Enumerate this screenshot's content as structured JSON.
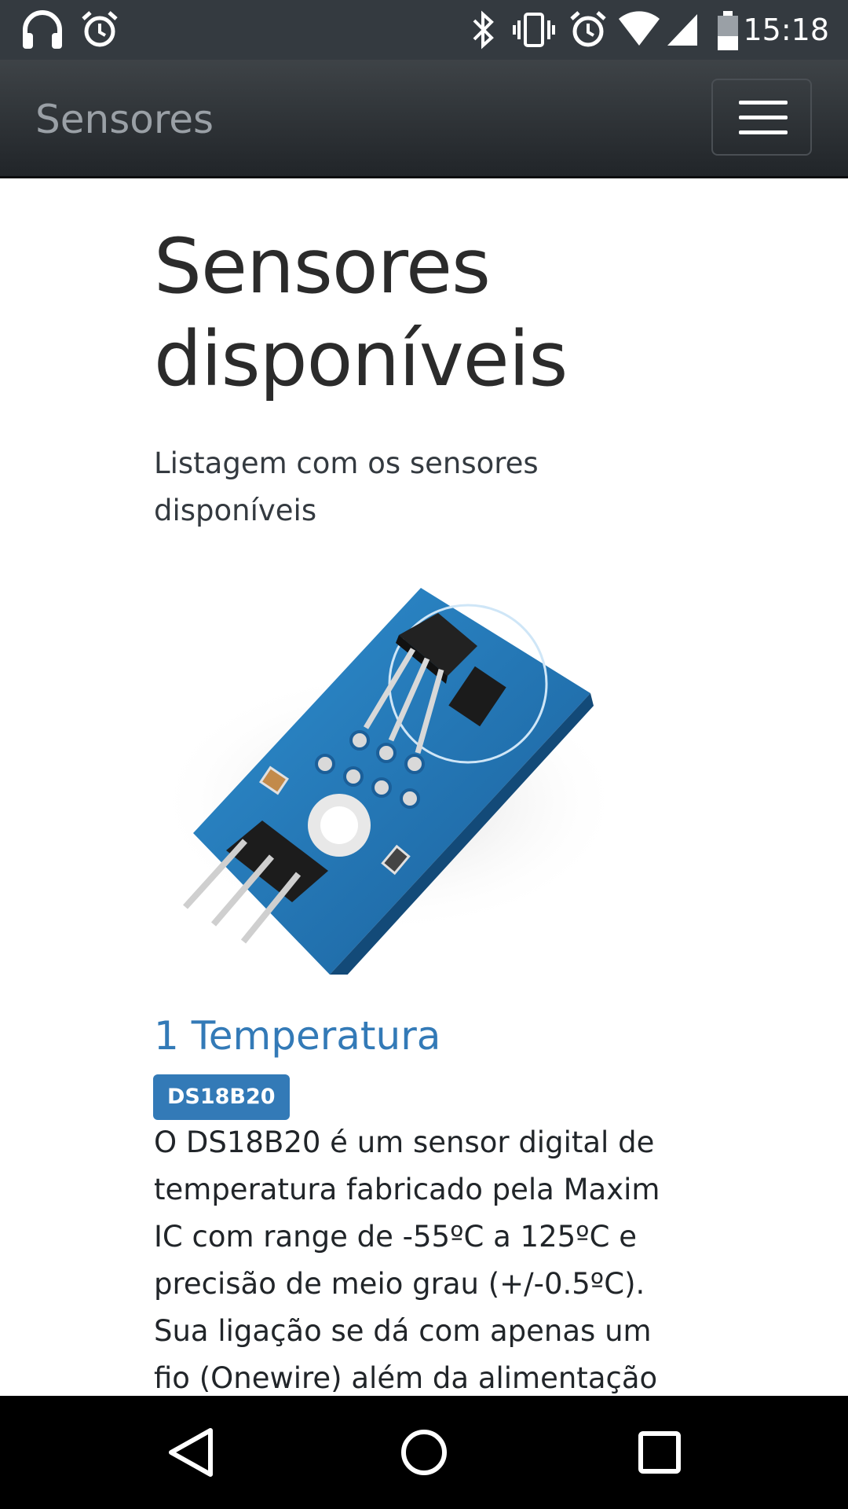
{
  "status_bar": {
    "time": "15:18",
    "left_icons": [
      "headphones-icon",
      "alarm-icon"
    ],
    "right_icons": [
      "bluetooth-icon",
      "vibrate-icon",
      "alarm-icon",
      "wifi-icon",
      "cell-signal-icon",
      "battery-icon"
    ]
  },
  "navbar": {
    "brand": "Sensores",
    "menu_icon": "hamburger-menu-icon"
  },
  "main": {
    "title": "Sensores disponíveis",
    "lead": "Listagem com os sensores disponíveis",
    "sensors": [
      {
        "title": "1 Temperatura",
        "badge": "DS18B20",
        "image_icon": "temperature-sensor-module-image",
        "description": "O DS18B20 é um sensor digital de temperatura fabricado pela Maxim IC com range de -55ºC a 125ºC e precisão de meio grau (+/-0.5ºC). Sua ligação se dá com apenas um fio (Onewire) além da alimentação"
      }
    ]
  },
  "colors": {
    "navbar": "#343a40",
    "accent": "#337ab7",
    "system_nav": "#000000"
  },
  "system_nav": [
    "back-icon",
    "home-icon",
    "recents-icon"
  ]
}
